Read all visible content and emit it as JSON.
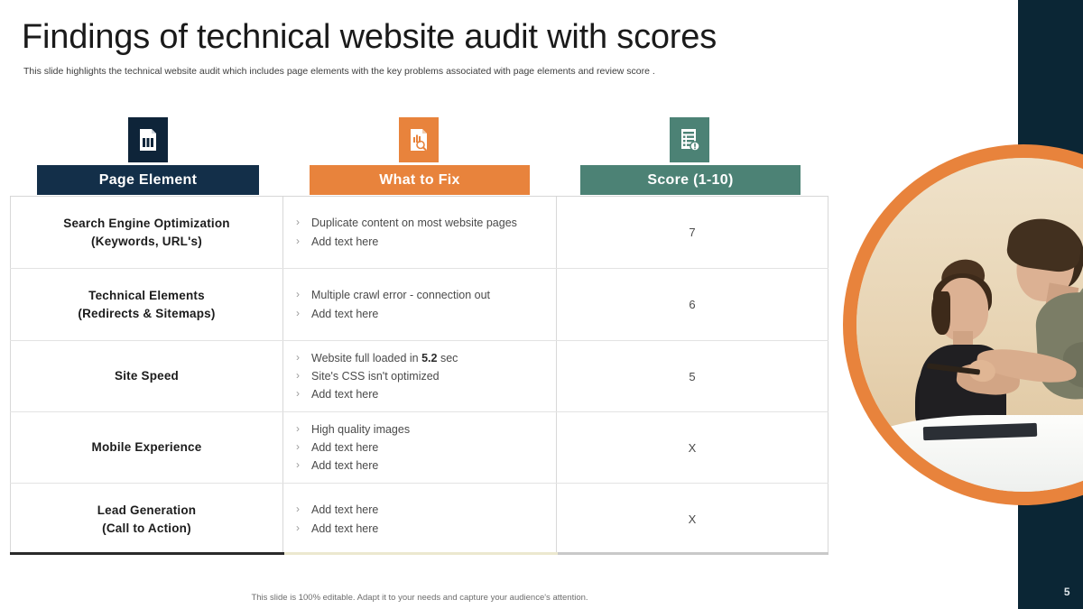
{
  "slide": {
    "title": "Findings of technical website audit with scores",
    "subtitle": "This slide highlights the technical website audit which includes page elements with the key problems associated with page elements and review score .",
    "footer_note": "This slide is 100% editable. Adapt it to your needs and capture your audience's attention.",
    "page_number": "5"
  },
  "colors": {
    "navy": "#132f49",
    "navy_dark": "#0b2635",
    "orange": "#e8833c",
    "teal": "#4c8275",
    "text_dark": "#1c1c1c",
    "text_body": "#4a4a4a"
  },
  "columns": [
    {
      "key": "page_element",
      "label": "Page Element",
      "icon": "report-document-icon",
      "accent": "#132f49"
    },
    {
      "key": "what_to_fix",
      "label": "What to Fix",
      "icon": "document-search-icon",
      "accent": "#e8833c"
    },
    {
      "key": "score",
      "label": "Score (1-10)",
      "icon": "checklist-alert-icon",
      "accent": "#4c8275"
    }
  ],
  "rows": [
    {
      "element_line1": "Search Engine Optimization",
      "element_line2": "(Keywords, URL's)",
      "fixes": [
        {
          "text": "Duplicate content on most website pages"
        },
        {
          "text": "Add text here"
        }
      ],
      "score": "7"
    },
    {
      "element_line1": "Technical Elements",
      "element_line2": "(Redirects & Sitemaps)",
      "fixes": [
        {
          "text": "Multiple crawl error - connection out"
        },
        {
          "text": "Add text here"
        }
      ],
      "score": "6"
    },
    {
      "element_line1": "Site Speed",
      "element_line2": "",
      "fixes": [
        {
          "pre": "Website full loaded in ",
          "strong": "5.2",
          "post": " sec"
        },
        {
          "text": "Site's CSS isn't optimized"
        },
        {
          "text": "Add text here"
        }
      ],
      "score": "5"
    },
    {
      "element_line1": "Mobile Experience",
      "element_line2": "",
      "fixes": [
        {
          "text": "High quality images"
        },
        {
          "text": "Add text here"
        },
        {
          "text": "Add text here"
        }
      ],
      "score": "X"
    },
    {
      "element_line1": "Lead Generation",
      "element_line2": "(Call to Action)",
      "fixes": [
        {
          "text": "Add text here"
        },
        {
          "text": "Add text here"
        }
      ],
      "score": "X"
    }
  ],
  "bullet_glyph": "›",
  "photo": {
    "alt": "two colleagues reviewing work at a desk, man pointing with a pen"
  }
}
